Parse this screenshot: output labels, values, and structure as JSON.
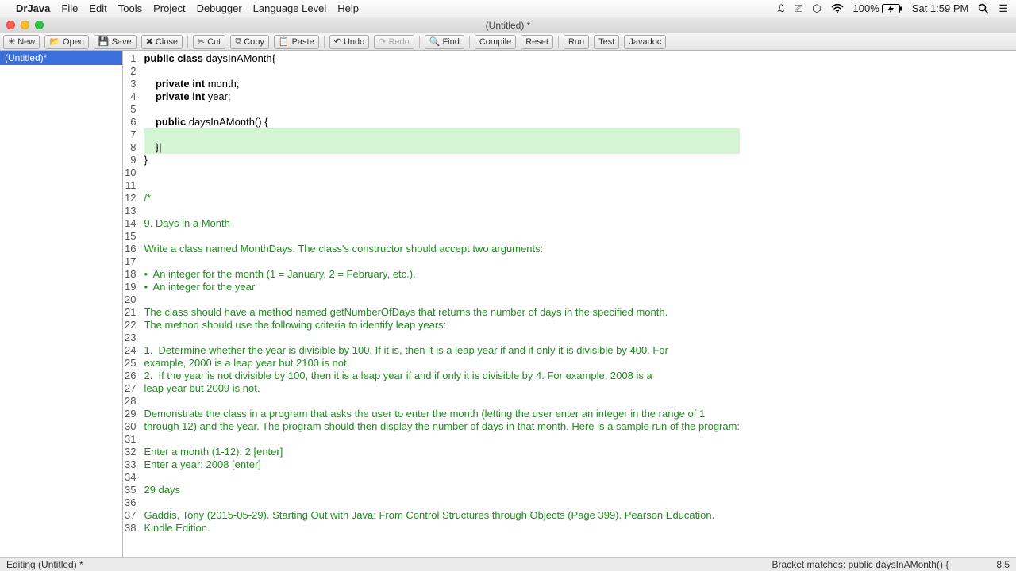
{
  "menubar": {
    "app": "DrJava",
    "items": [
      "File",
      "Edit",
      "Tools",
      "Project",
      "Debugger",
      "Language Level",
      "Help"
    ],
    "right": {
      "battery": "100%",
      "clock": "Sat 1:59 PM"
    }
  },
  "window": {
    "title": "(Untitled) *"
  },
  "toolbar": {
    "new": "New",
    "open": "Open",
    "save": "Save",
    "close": "Close",
    "cut": "Cut",
    "copy": "Copy",
    "paste": "Paste",
    "undo": "Undo",
    "redo": "Redo",
    "find": "Find",
    "compile": "Compile",
    "reset": "Reset",
    "run": "Run",
    "test": "Test",
    "javadoc": "Javadoc"
  },
  "sidebar": {
    "file": "(Untitled)*"
  },
  "code_lines": [
    {
      "n": 1,
      "t": "code",
      "text": "public class daysInAMonth{",
      "tokens": [
        [
          "kw",
          "public"
        ],
        [
          "sp",
          " "
        ],
        [
          "kw",
          "class"
        ],
        [
          "sp",
          " "
        ],
        [
          "id",
          "daysInAMonth{"
        ]
      ]
    },
    {
      "n": 2,
      "t": "code",
      "text": ""
    },
    {
      "n": 3,
      "t": "code",
      "text": "    private int month;",
      "tokens": [
        [
          "sp",
          "    "
        ],
        [
          "kw",
          "private"
        ],
        [
          "sp",
          " "
        ],
        [
          "kw",
          "int"
        ],
        [
          "sp",
          " "
        ],
        [
          "id",
          "month;"
        ]
      ]
    },
    {
      "n": 4,
      "t": "code",
      "text": "    private int year;",
      "tokens": [
        [
          "sp",
          "    "
        ],
        [
          "kw",
          "private"
        ],
        [
          "sp",
          " "
        ],
        [
          "kw",
          "int"
        ],
        [
          "sp",
          " "
        ],
        [
          "id",
          "year;"
        ]
      ]
    },
    {
      "n": 5,
      "t": "code",
      "text": ""
    },
    {
      "n": 6,
      "t": "code",
      "text": "    public daysInAMonth() {",
      "tokens": [
        [
          "sp",
          "    "
        ],
        [
          "kw",
          "public"
        ],
        [
          "sp",
          " "
        ],
        [
          "id",
          "daysInAMonth() {"
        ]
      ]
    },
    {
      "n": 7,
      "t": "code",
      "text": "",
      "hl": true
    },
    {
      "n": 8,
      "t": "code",
      "text": "    }|",
      "hl": true
    },
    {
      "n": 9,
      "t": "code",
      "text": "}"
    },
    {
      "n": 10,
      "t": "code",
      "text": ""
    },
    {
      "n": 11,
      "t": "code",
      "text": ""
    },
    {
      "n": 12,
      "t": "comment",
      "text": "/*"
    },
    {
      "n": 13,
      "t": "comment",
      "text": ""
    },
    {
      "n": 14,
      "t": "comment",
      "text": "9. Days in a Month"
    },
    {
      "n": 15,
      "t": "comment",
      "text": ""
    },
    {
      "n": 16,
      "t": "comment",
      "text": "Write a class named MonthDays. The class's constructor should accept two arguments:"
    },
    {
      "n": 17,
      "t": "comment",
      "text": ""
    },
    {
      "n": 18,
      "t": "comment",
      "text": "•  An integer for the month (1 = January, 2 = February, etc.)."
    },
    {
      "n": 19,
      "t": "comment",
      "text": "•  An integer for the year"
    },
    {
      "n": 20,
      "t": "comment",
      "text": ""
    },
    {
      "n": 21,
      "t": "comment",
      "text": "The class should have a method named getNumberOfDays that returns the number of days in the specified month."
    },
    {
      "n": 22,
      "t": "comment",
      "text": "The method should use the following criteria to identify leap years:"
    },
    {
      "n": 23,
      "t": "comment",
      "text": ""
    },
    {
      "n": 24,
      "t": "comment",
      "text": "1.  Determine whether the year is divisible by 100. If it is, then it is a leap year if and if only it is divisible by 400. For"
    },
    {
      "n": 25,
      "t": "comment",
      "text": "example, 2000 is a leap year but 2100 is not."
    },
    {
      "n": 26,
      "t": "comment",
      "text": "2.  If the year is not divisible by 100, then it is a leap year if and if only it is divisible by 4. For example, 2008 is a"
    },
    {
      "n": 27,
      "t": "comment",
      "text": "leap year but 2009 is not."
    },
    {
      "n": 28,
      "t": "comment",
      "text": ""
    },
    {
      "n": 29,
      "t": "comment",
      "text": "Demonstrate the class in a program that asks the user to enter the month (letting the user enter an integer in the range of 1"
    },
    {
      "n": 30,
      "t": "comment",
      "text": "through 12) and the year. The program should then display the number of days in that month. Here is a sample run of the program:"
    },
    {
      "n": 31,
      "t": "comment",
      "text": ""
    },
    {
      "n": 32,
      "t": "comment",
      "text": "Enter a month (1-12): 2 [enter]"
    },
    {
      "n": 33,
      "t": "comment",
      "text": "Enter a year: 2008 [enter]"
    },
    {
      "n": 34,
      "t": "comment",
      "text": ""
    },
    {
      "n": 35,
      "t": "comment",
      "text": "29 days"
    },
    {
      "n": 36,
      "t": "comment",
      "text": ""
    },
    {
      "n": 37,
      "t": "comment",
      "text": "Gaddis, Tony (2015-05-29). Starting Out with Java: From Control Structures through Objects (Page 399). Pearson Education."
    },
    {
      "n": 38,
      "t": "comment",
      "text": "Kindle Edition."
    }
  ],
  "status": {
    "left": "Editing (Untitled) *",
    "bracket": "Bracket matches:      public daysInAMonth() {",
    "pos": "8:5"
  }
}
